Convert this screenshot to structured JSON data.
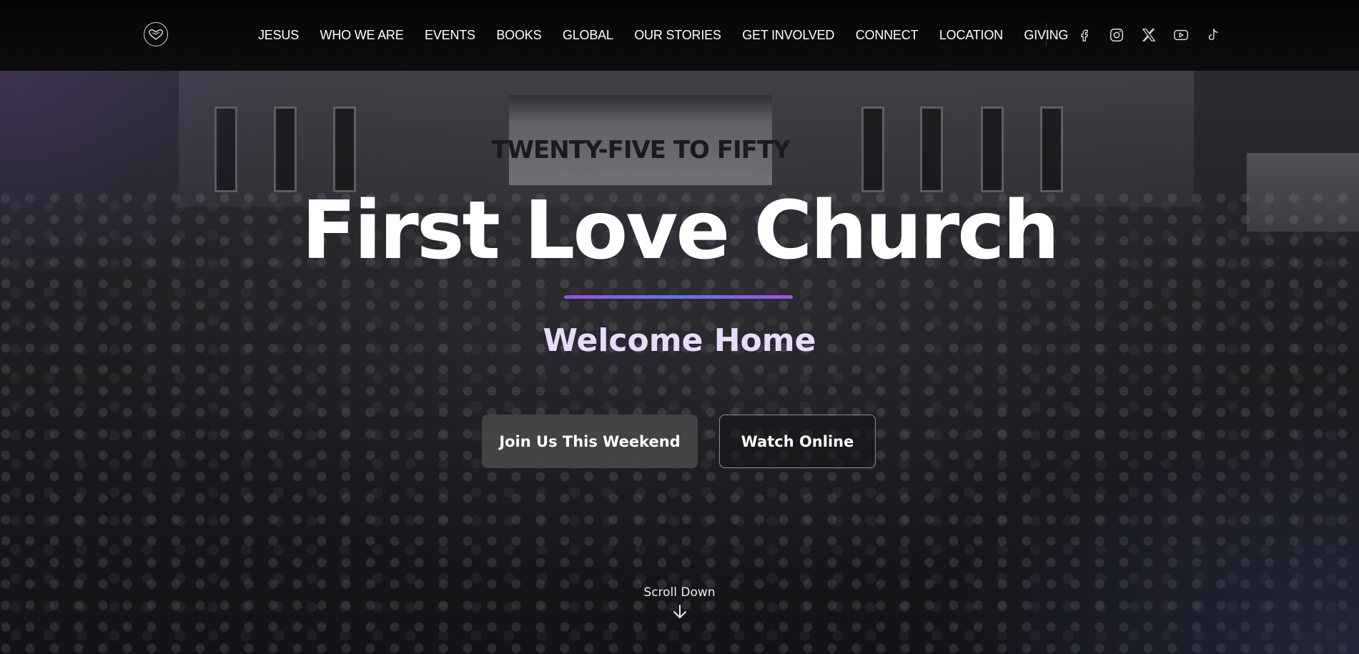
{
  "nav": {
    "logo_icon": "heart-dove-logo",
    "links": [
      {
        "label": "JESUS"
      },
      {
        "label": "WHO WE ARE"
      },
      {
        "label": "EVENTS"
      },
      {
        "label": "BOOKS"
      },
      {
        "label": "GLOBAL"
      },
      {
        "label": "OUR STORIES"
      },
      {
        "label": "GET INVOLVED"
      },
      {
        "label": "CONNECT"
      },
      {
        "label": "LOCATION"
      },
      {
        "label": "GIVING"
      }
    ],
    "socials": [
      {
        "icon": "facebook-icon"
      },
      {
        "icon": "instagram-icon"
      },
      {
        "icon": "x-twitter-icon"
      },
      {
        "icon": "youtube-icon"
      },
      {
        "icon": "tiktok-icon"
      }
    ]
  },
  "hero": {
    "banner_text": "TWENTY-FIVE TO FIFTY",
    "title": "First Love Church",
    "subtitle": "Welcome Home",
    "primary_button": "Join Us This Weekend",
    "secondary_button": "Watch Online",
    "scroll_label": "Scroll Down"
  },
  "colors": {
    "nav_background": "#0b0b0d",
    "subtitle": "#e9dcfb",
    "underline_start": "#9b4fe0",
    "underline_mid": "#5a78e8",
    "underline_end": "#a64fdc",
    "primary_button_bg": "#464648"
  }
}
